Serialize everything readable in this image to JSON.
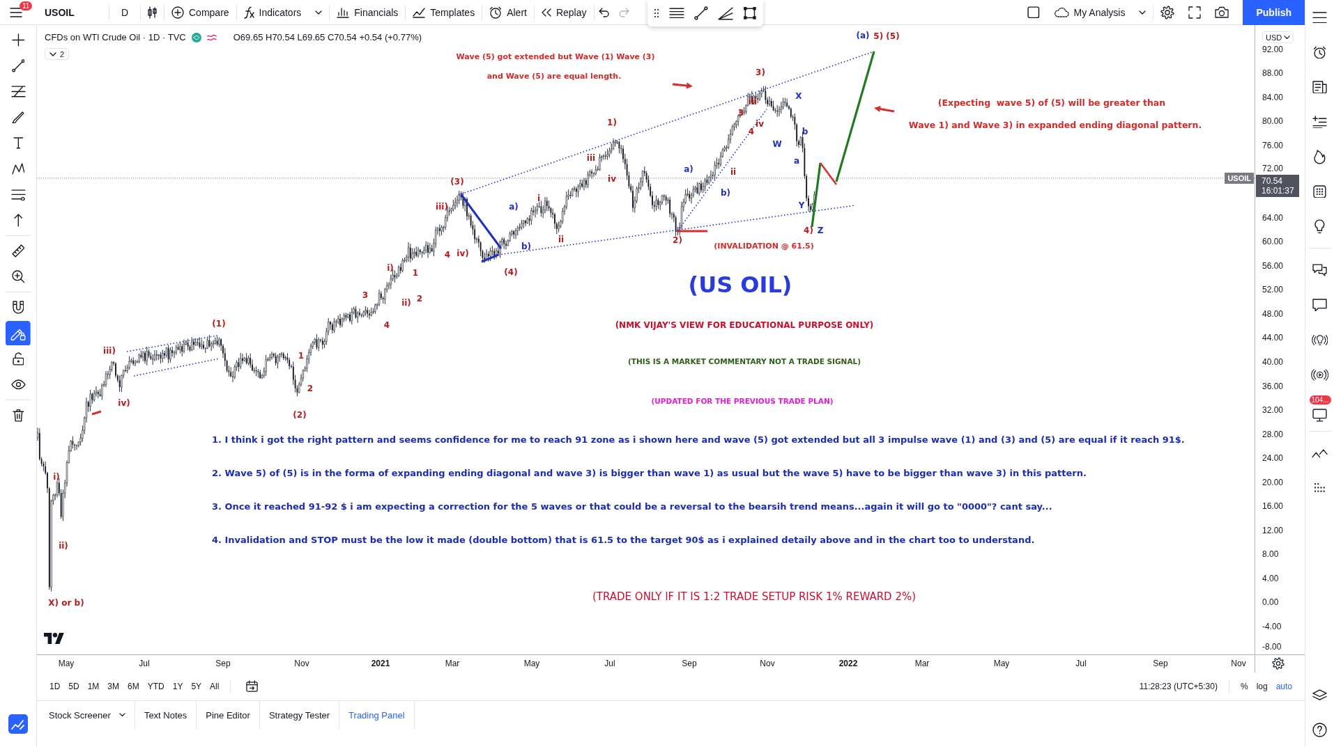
{
  "toolbar": {
    "menu_badge": "11",
    "symbol": "USOIL",
    "interval": "D",
    "actions": [
      "Compare",
      "Indicators",
      "Financials",
      "Templates",
      "Alert",
      "Replay"
    ],
    "history": [
      {
        "disabled": false
      },
      {
        "disabled": true
      }
    ],
    "layout_name": "My Analysis",
    "publish": "Publish"
  },
  "left_toolbar": {
    "tools": [
      {
        "selected": false
      },
      {
        "selected": false
      },
      {
        "selected": false
      },
      {
        "selected": false
      },
      {
        "selected": false
      },
      {
        "selected": false
      },
      {
        "selected": false
      },
      {
        "selected": false
      },
      {
        "selected": false
      },
      {
        "selected": false
      },
      {
        "selected": false
      },
      {
        "selected": true
      },
      {
        "selected": false
      },
      {
        "selected": false
      },
      {
        "selected": false
      }
    ]
  },
  "chart": {
    "legend": {
      "title": "CFDs on WTI Crude Oil · 1D · TVC",
      "ohlc": "O69.65 H70.54 L69.65 C70.54 +0.54 (+0.77%)",
      "indicator_count": "2"
    },
    "wave_labels": [
      {
        "text": "(a)",
        "color": "#1f2fbf"
      },
      {
        "text": "5) (5)",
        "color": "#b71c1c"
      },
      {
        "text": "3)",
        "color": "#b71c1c"
      },
      {
        "text": "X",
        "color": "#1f2fbf"
      },
      {
        "text": "iii",
        "color": "#b71c1c"
      },
      {
        "text": "3",
        "color": "#b71c1c"
      },
      {
        "text": "iv",
        "color": "#b71c1c"
      },
      {
        "text": "4",
        "color": "#b71c1c"
      },
      {
        "text": "ii",
        "color": "#b71c1c"
      },
      {
        "text": "1)",
        "color": "#b71c1c"
      },
      {
        "text": "iii",
        "color": "#b71c1c"
      },
      {
        "text": "iv",
        "color": "#b71c1c"
      },
      {
        "text": "a)",
        "color": "#1f2fbf"
      },
      {
        "text": "b)",
        "color": "#1f2fbf"
      },
      {
        "text": "W",
        "color": "#1f2fbf"
      },
      {
        "text": "b",
        "color": "#1f2fbf"
      },
      {
        "text": "a",
        "color": "#1f2fbf"
      },
      {
        "text": "Y",
        "color": "#1f2fbf"
      },
      {
        "text": "4)",
        "color": "#b71c1c"
      },
      {
        "text": "Z",
        "color": "#1f2fbf"
      },
      {
        "text": "2)",
        "color": "#b71c1c"
      },
      {
        "text": "(3)",
        "color": "#b71c1c"
      },
      {
        "text": "iii)",
        "color": "#b71c1c"
      },
      {
        "text": "a)",
        "color": "#1f2fbf"
      },
      {
        "text": "i",
        "color": "#b71c1c"
      },
      {
        "text": "b)",
        "color": "#1f2fbf"
      },
      {
        "text": "ii",
        "color": "#b71c1c"
      },
      {
        "text": "iv)",
        "color": "#b71c1c"
      },
      {
        "text": "4",
        "color": "#b71c1c"
      },
      {
        "text": "(4)",
        "color": "#b71c1c"
      },
      {
        "text": "i)",
        "color": "#b71c1c"
      },
      {
        "text": "1",
        "color": "#b71c1c"
      },
      {
        "text": "3",
        "color": "#b71c1c"
      },
      {
        "text": "ii)",
        "color": "#b71c1c"
      },
      {
        "text": "2",
        "color": "#b71c1c"
      },
      {
        "text": "4",
        "color": "#b71c1c"
      },
      {
        "text": "(1)",
        "color": "#b71c1c"
      },
      {
        "text": "iii)",
        "color": "#b71c1c"
      },
      {
        "text": "iv)",
        "color": "#b71c1c"
      },
      {
        "text": "1",
        "color": "#b71c1c"
      },
      {
        "text": "2",
        "color": "#b71c1c"
      },
      {
        "text": "(2)",
        "color": "#b71c1c"
      },
      {
        "text": "i)",
        "color": "#b71c1c"
      },
      {
        "text": "ii)",
        "color": "#b71c1c"
      },
      {
        "text": "X) or b)",
        "color": "#b71c1c"
      }
    ],
    "callouts": [
      "Wave (5) got extended but Wave (1) Wave (3)",
      "and Wave (5) are equal length.",
      "(Expecting  wave 5) of (5) will be greater than",
      "Wave 1) and Wave 3) in expanded ending diagonal pattern.",
      "(INVALIDATION @ 61.5)"
    ],
    "title": "(US OIL)",
    "remarks": [
      {
        "text": "(NMK VIJAY'S VIEW FOR EDUCATIONAL PURPOSE ONLY)",
        "color": "#c8102e"
      },
      {
        "text": "(THIS IS A MARKET COMMENTARY NOT A TRADE SIGNAL)",
        "color": "#2e5d1a"
      },
      {
        "text": "(UPDATED FOR THE PREVIOUS TRADE PLAN)",
        "color": "#e01fd0"
      }
    ],
    "points": [
      "1. I think i got the right pattern and seems confidence for me to reach 91 zone as i shown here and wave (5) got extended but all 3 impulse wave (1) and (3) and (5) are equal if it reach 91$.",
      "2. Wave 5) of (5) is in the forma of expanding ending diagonal and wave 3) is bigger than wave 1) as usual but the wave 5) have to be bigger than wave 3) in this pattern.",
      "3. Once it reached 91-92 $ i am expecting a correction for the 5 waves or that could be a reversal to the bearsih trend means...again it will go to \"0000\"? cant say...",
      "4. Invalidation and STOP must be the low it made (double bottom) that is 61.5 to the target 90$ as i explained detaily above and in the chart too to understand."
    ],
    "footer": "(TRADE ONLY IF IT IS 1:2 TRADE SETUP RISK 1% REWARD 2%)"
  },
  "price_axis": {
    "currency": "USD",
    "ticks": [
      "92.00",
      "88.00",
      "84.00",
      "80.00",
      "76.00",
      "72.00",
      "64.00",
      "60.00",
      "56.00",
      "52.00",
      "48.00",
      "44.00",
      "40.00",
      "36.00",
      "32.00",
      "28.00",
      "24.00",
      "20.00",
      "16.00",
      "12.00",
      "8.00",
      "4.00",
      "0.00",
      "-4.00",
      "-8.00"
    ],
    "symbol_tag": "USOIL",
    "last_price": "70.54",
    "countdown": "16:01:37"
  },
  "time_axis": {
    "labels": [
      {
        "text": "May",
        "kind": "month"
      },
      {
        "text": "Jul",
        "kind": "month"
      },
      {
        "text": "Sep",
        "kind": "month"
      },
      {
        "text": "Nov",
        "kind": "month"
      },
      {
        "text": "2021",
        "kind": "year"
      },
      {
        "text": "Mar",
        "kind": "month"
      },
      {
        "text": "May",
        "kind": "month"
      },
      {
        "text": "Jul",
        "kind": "month"
      },
      {
        "text": "Sep",
        "kind": "month"
      },
      {
        "text": "Nov",
        "kind": "month"
      },
      {
        "text": "2022",
        "kind": "year"
      },
      {
        "text": "Mar",
        "kind": "month"
      },
      {
        "text": "May",
        "kind": "month"
      },
      {
        "text": "Jul",
        "kind": "month"
      },
      {
        "text": "Sep",
        "kind": "month"
      },
      {
        "text": "Nov",
        "kind": "month"
      }
    ]
  },
  "range_bar": {
    "ranges": [
      {
        "label": "1D",
        "selected": false
      },
      {
        "label": "5D",
        "selected": false
      },
      {
        "label": "1M",
        "selected": false
      },
      {
        "label": "3M",
        "selected": false
      },
      {
        "label": "6M",
        "selected": false
      },
      {
        "label": "YTD",
        "selected": false
      },
      {
        "label": "1Y",
        "selected": false
      },
      {
        "label": "5Y",
        "selected": false
      },
      {
        "label": "All",
        "selected": false
      }
    ],
    "clock": "11:28:23 (UTC+5:30)",
    "scale_options": [
      {
        "label": "%",
        "selected": false
      },
      {
        "label": "log",
        "selected": false
      },
      {
        "label": "auto",
        "selected": true
      }
    ]
  },
  "bottom_tabs": [
    {
      "label": "Stock Screener",
      "selected": false
    },
    {
      "label": "Text Notes",
      "selected": false
    },
    {
      "label": "Pine Editor",
      "selected": false
    },
    {
      "label": "Strategy Tester",
      "selected": false
    },
    {
      "label": "Trading Panel",
      "selected": true
    }
  ],
  "right_sidebar": {
    "notification_badge": "104..."
  }
}
